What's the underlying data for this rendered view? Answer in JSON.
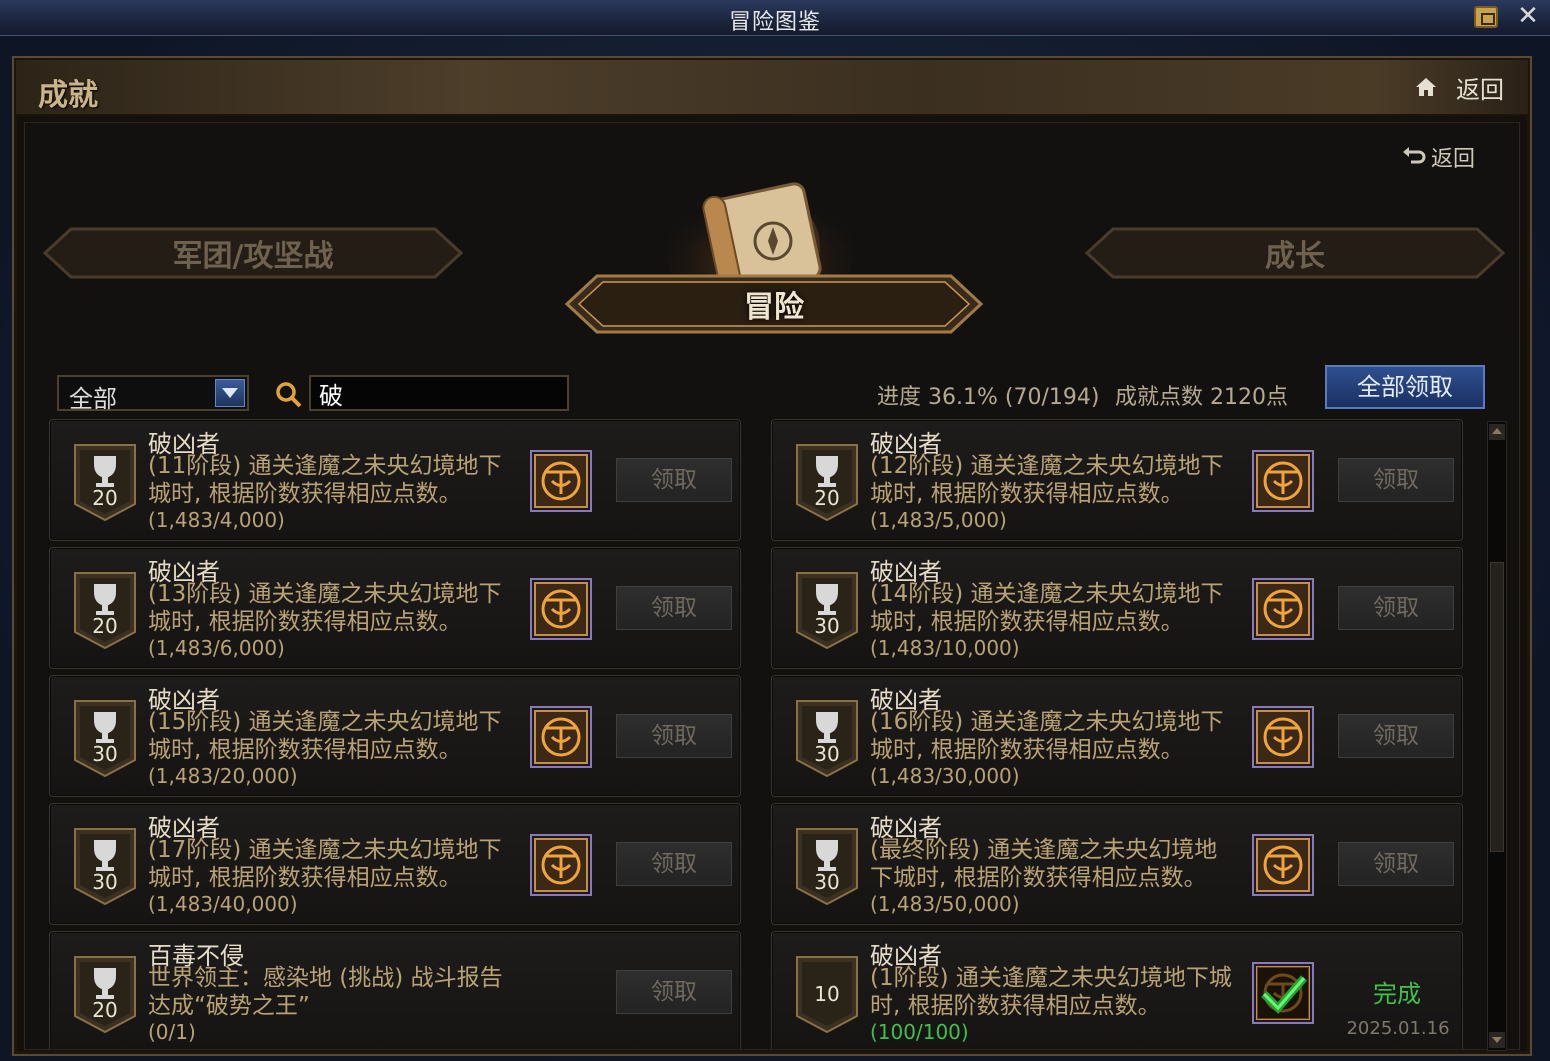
{
  "window": {
    "title": "冒险图鉴"
  },
  "header": {
    "title": "成就",
    "back_label": "返回"
  },
  "sub_back_label": "返回",
  "categories": {
    "left": "军团/攻坚战",
    "center": "冒险",
    "right": "成长"
  },
  "toolbar": {
    "filter_value": "全部",
    "search_value": "破",
    "progress_text": "进度 36.1% (70/194)",
    "points_text": "成就点数 2120点",
    "claim_all_label": "全部领取"
  },
  "colors": {
    "accent_blue": "#2f4f8f",
    "complete_green": "#3ec24a",
    "gold_text": "#b9a274"
  },
  "achievements": [
    {
      "points": "20",
      "name": "破凶者",
      "desc": "(11阶段) 通关逢魔之未央幻境地下城时, 根据阶数获得相应点数。",
      "progress": "(1,483/4,000)",
      "action": "领取"
    },
    {
      "points": "20",
      "name": "破凶者",
      "desc": "(12阶段) 通关逢魔之未央幻境地下城时, 根据阶数获得相应点数。",
      "progress": "(1,483/5,000)",
      "action": "领取"
    },
    {
      "points": "20",
      "name": "破凶者",
      "desc": "(13阶段) 通关逢魔之未央幻境地下城时, 根据阶数获得相应点数。",
      "progress": "(1,483/6,000)",
      "action": "领取"
    },
    {
      "points": "30",
      "name": "破凶者",
      "desc": "(14阶段) 通关逢魔之未央幻境地下城时, 根据阶数获得相应点数。",
      "progress": "(1,483/10,000)",
      "action": "领取"
    },
    {
      "points": "30",
      "name": "破凶者",
      "desc": "(15阶段) 通关逢魔之未央幻境地下城时, 根据阶数获得相应点数。",
      "progress": "(1,483/20,000)",
      "action": "领取"
    },
    {
      "points": "30",
      "name": "破凶者",
      "desc": "(16阶段) 通关逢魔之未央幻境地下城时, 根据阶数获得相应点数。",
      "progress": "(1,483/30,000)",
      "action": "领取"
    },
    {
      "points": "30",
      "name": "破凶者",
      "desc": "(17阶段) 通关逢魔之未央幻境地下城时, 根据阶数获得相应点数。",
      "progress": "(1,483/40,000)",
      "action": "领取"
    },
    {
      "points": "30",
      "name": "破凶者",
      "desc": "(最终阶段) 通关逢魔之未央幻境地下城时, 根据阶数获得相应点数。",
      "progress": "(1,483/50,000)",
      "action": "领取"
    },
    {
      "points": "20",
      "name": "百毒不侵",
      "desc": "世界领主：感染地 (挑战) 战斗报告达成“破势之王”",
      "progress": "(0/1)",
      "action": "领取"
    },
    {
      "points": "10",
      "name": "破凶者",
      "desc": "(1阶段) 通关逢魔之未央幻境地下城时, 根据阶数获得相应点数。",
      "progress": "(100/100)",
      "status": "完成",
      "date": "2025.01.16"
    }
  ]
}
